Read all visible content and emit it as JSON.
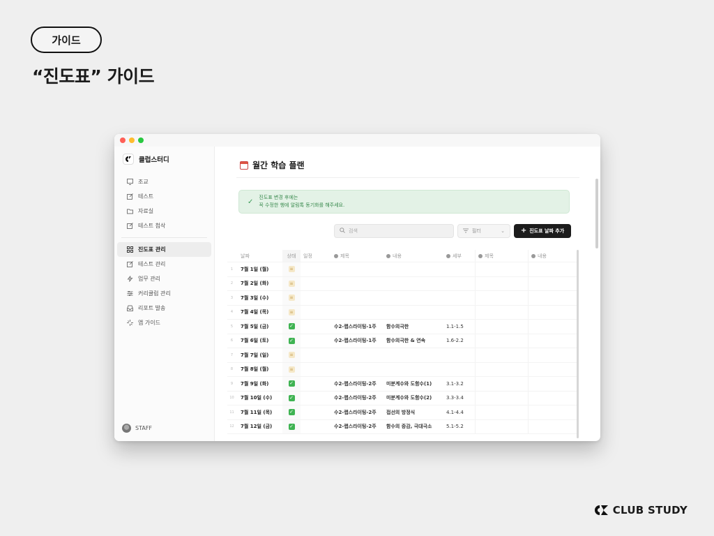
{
  "slide": {
    "pill_label": "가이드",
    "headline": "“진도표” 가이드",
    "brand_name": "CLUB STUDY",
    "brand_mark": "CS"
  },
  "window": {
    "controls": {
      "close": "#ff5f57",
      "minimize": "#febc2e",
      "maximize": "#28c840"
    }
  },
  "sidebar": {
    "brand": "클럽스터디",
    "items": [
      {
        "label": "조교",
        "icon": "monitor-icon"
      },
      {
        "label": "테스트",
        "icon": "edit-box-icon"
      },
      {
        "label": "자료실",
        "icon": "folder-icon"
      },
      {
        "label": "테스트 첨삭",
        "icon": "edit-box-icon"
      },
      {
        "label": "진도표 관리",
        "icon": "grid-icon",
        "active": true
      },
      {
        "label": "테스트 관리",
        "icon": "edit-box-icon"
      },
      {
        "label": "업무 관리",
        "icon": "lightning-icon"
      },
      {
        "label": "커리큘럼 관리",
        "icon": "sliders-icon"
      },
      {
        "label": "리포트 발송",
        "icon": "inbox-icon"
      },
      {
        "label": "앱 가이드",
        "icon": "sparkle-icon"
      }
    ],
    "user": "STAFF"
  },
  "main": {
    "title": "월간 학습 플랜",
    "banner": {
      "line1": "진도표 변경 후에는",
      "line2": "꼭 수정한 행에 알림톡 동기화를 해주세요."
    },
    "search_placeholder": "검색",
    "filter_label": "필터",
    "add_button": "진도표 날짜 추가",
    "columns": {
      "date": "날짜",
      "status": "상태",
      "plan": "일정",
      "title": "제목",
      "content": "내용",
      "detail": "세부",
      "title2": "제목",
      "content2": "내용"
    },
    "rows": [
      {
        "num": "1",
        "date": "7월 1일 (월)",
        "status": "wait",
        "title": "",
        "content": "",
        "detail": ""
      },
      {
        "num": "2",
        "date": "7월 2일 (화)",
        "status": "wait",
        "title": "",
        "content": "",
        "detail": ""
      },
      {
        "num": "3",
        "date": "7월 3일 (수)",
        "status": "wait",
        "title": "",
        "content": "",
        "detail": ""
      },
      {
        "num": "4",
        "date": "7월 4일 (목)",
        "status": "wait",
        "title": "",
        "content": "",
        "detail": ""
      },
      {
        "num": "5",
        "date": "7월 5일 (금)",
        "status": "done",
        "title": "수2-랩스라이팅-1주",
        "content": "함수의극한",
        "detail": "1.1-1.5"
      },
      {
        "num": "6",
        "date": "7월 6일 (토)",
        "status": "done",
        "title": "수2-랩스라이팅-1주",
        "content": "함수의극한 & 연속",
        "detail": "1.6-2.2"
      },
      {
        "num": "7",
        "date": "7월 7일 (일)",
        "status": "wait",
        "title": "",
        "content": "",
        "detail": ""
      },
      {
        "num": "8",
        "date": "7월 8일 (월)",
        "status": "wait",
        "title": "",
        "content": "",
        "detail": ""
      },
      {
        "num": "9",
        "date": "7월 9일 (화)",
        "status": "done",
        "title": "수2-랩스라이팅-2주",
        "content": "미분계수와 도함수(1)",
        "detail": "3.1-3.2"
      },
      {
        "num": "10",
        "date": "7월 10일 (수)",
        "status": "done",
        "title": "수2-랩스라이팅-2주",
        "content": "미분계수와 도함수(2)",
        "detail": "3.3-3.4"
      },
      {
        "num": "11",
        "date": "7월 11일 (목)",
        "status": "done",
        "title": "수2-랩스라이팅-2주",
        "content": "접선의 방정식",
        "detail": "4.1-4.4"
      },
      {
        "num": "12",
        "date": "7월 12일 (금)",
        "status": "done",
        "title": "수2-랩스라이팅-2주",
        "content": "함수의 증감, 극대극소",
        "detail": "5.1-5.2"
      }
    ]
  }
}
